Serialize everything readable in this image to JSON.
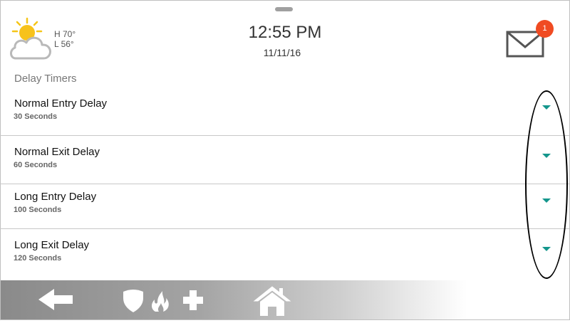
{
  "header": {
    "weather": {
      "icon": "partly-cloudy-icon",
      "high": "H 70°",
      "low": "L 56°"
    },
    "time": "12:55 PM",
    "date": "11/11/16",
    "messages": {
      "icon": "mail-icon",
      "unread_count": "1"
    }
  },
  "section": {
    "title": "Delay Timers",
    "items": [
      {
        "label": "Normal Entry Delay",
        "value": "30 Seconds",
        "icon": "chevron-down-icon"
      },
      {
        "label": "Normal Exit Delay",
        "value": "60 Seconds",
        "icon": "chevron-down-icon"
      },
      {
        "label": "Long Entry Delay",
        "value": "100 Seconds",
        "icon": "chevron-down-icon"
      },
      {
        "label": "Long Exit Delay",
        "value": "120 Seconds",
        "icon": "chevron-down-icon"
      }
    ]
  },
  "bottom_nav": {
    "icons": [
      "back-arrow-icon",
      "security-shield-icon",
      "fire-icon",
      "medical-cross-icon",
      "home-icon"
    ]
  },
  "colors": {
    "accent": "#14968c",
    "badge": "#f04b22",
    "nav_gradient_start": "#8a8a8a"
  }
}
